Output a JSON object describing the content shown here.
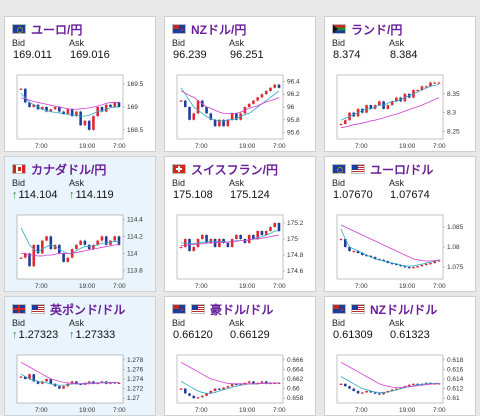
{
  "cards": [
    {
      "pair": "ユーロ/円",
      "flag": "eu",
      "bid_label": "Bid",
      "ask_label": "Ask",
      "bid": "169.011",
      "ask": "169.016",
      "arrow": "",
      "highlight": false,
      "y_ticks": [
        "169.5",
        "169",
        "168.5"
      ],
      "x_ticks": [
        "7:00",
        "19:00",
        "7:00"
      ],
      "ylim": [
        168.3,
        169.7
      ],
      "candles": [
        169.4,
        169.1,
        169.0,
        169.05,
        168.95,
        169.0,
        168.9,
        168.95,
        169.0,
        168.9,
        168.85,
        168.95,
        168.8,
        168.9,
        168.6,
        168.7,
        168.5,
        168.8,
        169.0,
        168.9,
        169.05,
        169.0,
        169.1,
        169.0
      ],
      "ma1": [
        169.3,
        169.2,
        169.1,
        169.05,
        169.0,
        168.95,
        168.92,
        168.9,
        168.88,
        168.87,
        168.85,
        168.84,
        168.83,
        168.82,
        168.8,
        168.8,
        168.82,
        168.86,
        168.9,
        168.92,
        168.95,
        168.98,
        169.0,
        169.0
      ],
      "ma2": [
        169.2,
        169.18,
        169.15,
        169.12,
        169.1,
        169.08,
        169.06,
        169.04,
        169.02,
        169.0,
        168.98,
        168.96,
        168.95,
        168.95,
        168.96,
        168.97,
        168.98,
        169.0,
        169.02,
        169.05,
        169.08,
        169.1,
        169.1,
        169.1
      ]
    },
    {
      "pair": "NZドル/円",
      "flag": "nz",
      "bid_label": "Bid",
      "ask_label": "Ask",
      "bid": "96.239",
      "ask": "96.251",
      "arrow": "",
      "highlight": false,
      "y_ticks": [
        "96.4",
        "96.2",
        "96",
        "95.8",
        "95.6"
      ],
      "x_ticks": [
        "7:00",
        "19:00",
        "7:00"
      ],
      "ylim": [
        95.5,
        96.5
      ],
      "candles": [
        96.1,
        96.0,
        95.8,
        95.9,
        96.1,
        96.0,
        95.9,
        95.8,
        95.7,
        95.8,
        95.7,
        95.8,
        95.9,
        95.8,
        95.9,
        96.0,
        96.05,
        96.1,
        96.15,
        96.2,
        96.25,
        96.3,
        96.35,
        96.3
      ],
      "ma1": [
        96.3,
        96.2,
        96.1,
        96.0,
        95.95,
        95.9,
        95.85,
        95.82,
        95.8,
        95.78,
        95.78,
        95.8,
        95.8,
        95.82,
        95.85,
        95.88,
        95.9,
        95.95,
        96.0,
        96.05,
        96.1,
        96.15,
        96.2,
        96.25
      ],
      "ma2": [
        96.25,
        96.22,
        96.18,
        96.15,
        96.1,
        96.05,
        96.0,
        95.98,
        95.95,
        95.92,
        95.9,
        95.9,
        95.9,
        95.9,
        95.92,
        95.95,
        95.98,
        96.0,
        96.02,
        96.05,
        96.08,
        96.1,
        96.12,
        96.15
      ]
    },
    {
      "pair": "ランド/円",
      "flag": "za",
      "bid_label": "Bid",
      "ask_label": "Ask",
      "bid": "8.374",
      "ask": "8.384",
      "arrow": "",
      "highlight": false,
      "y_ticks": [
        "8.35",
        "8.3",
        "8.25"
      ],
      "x_ticks": [
        "7:00",
        "19:00",
        "7:00"
      ],
      "ylim": [
        8.23,
        8.4
      ],
      "candles": [
        8.27,
        8.28,
        8.3,
        8.29,
        8.31,
        8.3,
        8.32,
        8.31,
        8.32,
        8.33,
        8.31,
        8.32,
        8.33,
        8.34,
        8.33,
        8.35,
        8.34,
        8.36,
        8.36,
        8.37,
        8.37,
        8.38,
        8.38,
        8.38
      ],
      "ma1": [
        8.28,
        8.285,
        8.29,
        8.295,
        8.3,
        8.305,
        8.31,
        8.31,
        8.315,
        8.32,
        8.32,
        8.325,
        8.33,
        8.33,
        8.335,
        8.34,
        8.345,
        8.35,
        8.355,
        8.36,
        8.365,
        8.37,
        8.372,
        8.375
      ],
      "ma2": [
        8.26,
        8.262,
        8.265,
        8.268,
        8.27,
        8.272,
        8.275,
        8.278,
        8.28,
        8.283,
        8.286,
        8.29,
        8.293,
        8.296,
        8.3,
        8.304,
        8.308,
        8.312,
        8.316,
        8.32,
        8.325,
        8.33,
        8.335,
        8.34
      ]
    },
    {
      "pair": "カナダドル/円",
      "flag": "ca",
      "bid_label": "Bid",
      "ask_label": "Ask",
      "bid": "114.104",
      "ask": "114.119",
      "arrow": "↑",
      "highlight": true,
      "y_ticks": [
        "114.4",
        "114.2",
        "114",
        "113.8"
      ],
      "x_ticks": [
        "7:00",
        "19:00",
        "7:00"
      ],
      "ylim": [
        113.7,
        114.45
      ],
      "candles": [
        113.95,
        114.0,
        113.85,
        114.1,
        114.0,
        114.15,
        114.2,
        114.05,
        114.1,
        114.0,
        113.9,
        113.95,
        114.05,
        114.1,
        114.15,
        114.1,
        114.05,
        114.1,
        114.15,
        114.2,
        114.1,
        114.15,
        114.2,
        114.1
      ],
      "ma1": [
        114.3,
        114.2,
        114.1,
        114.05,
        114.02,
        114.05,
        114.08,
        114.1,
        114.08,
        114.05,
        114.02,
        114.0,
        114.0,
        114.03,
        114.06,
        114.08,
        114.08,
        114.09,
        114.1,
        114.12,
        114.12,
        114.13,
        114.14,
        114.14
      ],
      "ma2": [
        114.0,
        114.0,
        113.98,
        113.98,
        113.97,
        113.97,
        113.98,
        113.98,
        113.99,
        114.0,
        114.0,
        114.0,
        114.0,
        114.01,
        114.02,
        114.03,
        114.04,
        114.05,
        114.06,
        114.07,
        114.08,
        114.09,
        114.1,
        114.1
      ]
    },
    {
      "pair": "スイスフラン/円",
      "flag": "ch",
      "bid_label": "Bid",
      "ask_label": "Ask",
      "bid": "175.108",
      "ask": "175.124",
      "arrow": "",
      "highlight": false,
      "y_ticks": [
        "175.2",
        "175",
        "174.8",
        "174.6"
      ],
      "x_ticks": [
        "7:00",
        "19:00",
        "7:00"
      ],
      "ylim": [
        174.5,
        175.3
      ],
      "candles": [
        174.9,
        175.0,
        174.85,
        174.9,
        175.0,
        175.05,
        174.95,
        175.0,
        174.9,
        175.0,
        174.95,
        174.9,
        175.0,
        175.05,
        175.0,
        174.95,
        175.05,
        175.0,
        175.1,
        175.05,
        175.1,
        175.15,
        175.2,
        175.1
      ],
      "ma1": [
        174.95,
        174.95,
        174.94,
        174.94,
        174.95,
        174.96,
        174.96,
        174.97,
        174.97,
        174.97,
        174.97,
        174.96,
        174.97,
        174.98,
        174.98,
        174.98,
        174.99,
        175.0,
        175.02,
        175.03,
        175.05,
        175.07,
        175.1,
        175.1
      ],
      "ma2": [
        174.92,
        174.92,
        174.93,
        174.93,
        174.94,
        174.94,
        174.95,
        174.95,
        174.95,
        174.96,
        174.96,
        174.96,
        174.97,
        174.97,
        174.98,
        174.98,
        174.99,
        175.0,
        175.0,
        175.01,
        175.02,
        175.03,
        175.04,
        175.05
      ]
    },
    {
      "pair": "ユーロ/ドル",
      "flag": "eu_us",
      "bid_label": "Bid",
      "ask_label": "Ask",
      "bid": "1.07670",
      "ask": "1.07674",
      "arrow": "",
      "highlight": false,
      "y_ticks": [
        "1.085",
        "1.08",
        "1.075"
      ],
      "x_ticks": [
        "7:00",
        "19:00",
        "7:00"
      ],
      "ylim": [
        1.072,
        1.088
      ],
      "candles": [
        1.082,
        1.08,
        1.079,
        1.079,
        1.0785,
        1.078,
        1.0778,
        1.0775,
        1.077,
        1.0768,
        1.0765,
        1.076,
        1.0758,
        1.0755,
        1.0752,
        1.075,
        1.0748,
        1.075,
        1.0752,
        1.0755,
        1.0758,
        1.076,
        1.0765,
        1.0767
      ],
      "ma1": [
        1.0845,
        1.082,
        1.08,
        1.0795,
        1.079,
        1.0785,
        1.078,
        1.0775,
        1.077,
        1.0768,
        1.0765,
        1.0762,
        1.076,
        1.0758,
        1.0755,
        1.0753,
        1.0752,
        1.0753,
        1.0755,
        1.0757,
        1.076,
        1.0762,
        1.0765,
        1.0767
      ],
      "ma2": [
        1.0855,
        1.085,
        1.0845,
        1.084,
        1.0835,
        1.083,
        1.0825,
        1.082,
        1.0815,
        1.081,
        1.0805,
        1.08,
        1.0795,
        1.079,
        1.0785,
        1.078,
        1.0775,
        1.077,
        1.0768,
        1.0766,
        1.0765,
        1.0765,
        1.0766,
        1.0767
      ]
    },
    {
      "pair": "英ポンド/ドル",
      "flag": "gb_us",
      "bid_label": "Bid",
      "ask_label": "Ask",
      "bid": "1.27323",
      "ask": "1.27333",
      "arrow": "↑",
      "highlight": true,
      "y_ticks": [
        "1.278",
        "1.276",
        "1.274",
        "1.272",
        "1.27"
      ],
      "x_ticks": [
        "7:00",
        "19:00",
        "7:00"
      ],
      "ylim": [
        1.269,
        1.279
      ],
      "candles": [
        1.2745,
        1.274,
        1.275,
        1.2735,
        1.273,
        1.2735,
        1.274,
        1.273,
        1.2725,
        1.272,
        1.2725,
        1.273,
        1.2735,
        1.273,
        1.2728,
        1.2732,
        1.2735,
        1.273,
        1.2732,
        1.2735,
        1.273,
        1.2733,
        1.2732,
        1.2732
      ],
      "ma1": [
        1.275,
        1.2745,
        1.274,
        1.2738,
        1.2735,
        1.2733,
        1.2732,
        1.273,
        1.2728,
        1.2727,
        1.2727,
        1.2728,
        1.273,
        1.273,
        1.273,
        1.2731,
        1.2732,
        1.2732,
        1.2732,
        1.2733,
        1.2733,
        1.2733,
        1.2733,
        1.2733
      ],
      "ma2": [
        1.2775,
        1.277,
        1.2765,
        1.276,
        1.2755,
        1.275,
        1.2745,
        1.274,
        1.2738,
        1.2735,
        1.2733,
        1.2732,
        1.2731,
        1.273,
        1.273,
        1.273,
        1.273,
        1.2731,
        1.2731,
        1.2732,
        1.2732,
        1.2732,
        1.2733,
        1.2733
      ]
    },
    {
      "pair": "豪ドル/ドル",
      "flag": "au_us",
      "bid_label": "Bid",
      "ask_label": "Ask",
      "bid": "0.66120",
      "ask": "0.66129",
      "arrow": "",
      "highlight": false,
      "y_ticks": [
        "0.666",
        "0.664",
        "0.662",
        "0.66",
        "0.658"
      ],
      "x_ticks": [
        "7:00",
        "19:00",
        "7:00"
      ],
      "ylim": [
        0.657,
        0.667
      ],
      "candles": [
        0.66,
        0.659,
        0.6585,
        0.658,
        0.6582,
        0.6585,
        0.659,
        0.6595,
        0.66,
        0.6598,
        0.6602,
        0.6605,
        0.661,
        0.6608,
        0.661,
        0.6612,
        0.6615,
        0.661,
        0.6612,
        0.6615,
        0.661,
        0.6612,
        0.6612,
        0.6612
      ],
      "ma1": [
        0.6615,
        0.661,
        0.6605,
        0.66,
        0.6595,
        0.6592,
        0.659,
        0.659,
        0.6592,
        0.6595,
        0.6598,
        0.66,
        0.6603,
        0.6605,
        0.6607,
        0.6608,
        0.661,
        0.661,
        0.661,
        0.6611,
        0.6611,
        0.6612,
        0.6612,
        0.6612
      ],
      "ma2": [
        0.6655,
        0.665,
        0.6645,
        0.664,
        0.6635,
        0.663,
        0.6625,
        0.662,
        0.6618,
        0.6615,
        0.6613,
        0.6611,
        0.661,
        0.661,
        0.661,
        0.661,
        0.661,
        0.661,
        0.661,
        0.6611,
        0.6611,
        0.6611,
        0.6612,
        0.6612
      ]
    },
    {
      "pair": "NZドル/ドル",
      "flag": "nz_us",
      "bid_label": "Bid",
      "ask_label": "Ask",
      "bid": "0.61309",
      "ask": "0.61323",
      "arrow": "",
      "highlight": false,
      "y_ticks": [
        "0.618",
        "0.616",
        "0.614",
        "0.612",
        "0.61"
      ],
      "x_ticks": [
        "7:00",
        "19:00",
        "7:00"
      ],
      "ylim": [
        0.609,
        0.619
      ],
      "candles": [
        0.613,
        0.6125,
        0.612,
        0.6115,
        0.611,
        0.6112,
        0.6115,
        0.6112,
        0.611,
        0.6108,
        0.6112,
        0.6115,
        0.6118,
        0.612,
        0.6122,
        0.6125,
        0.6128,
        0.613,
        0.6128,
        0.613,
        0.6132,
        0.613,
        0.6131,
        0.6131
      ],
      "ma1": [
        0.6145,
        0.614,
        0.6135,
        0.613,
        0.6125,
        0.612,
        0.6118,
        0.6115,
        0.6113,
        0.6112,
        0.6112,
        0.6113,
        0.6115,
        0.6117,
        0.612,
        0.6122,
        0.6124,
        0.6126,
        0.6128,
        0.6129,
        0.613,
        0.613,
        0.6131,
        0.6131
      ],
      "ma2": [
        0.6175,
        0.617,
        0.6165,
        0.616,
        0.6155,
        0.615,
        0.6145,
        0.614,
        0.6135,
        0.613,
        0.6127,
        0.6125,
        0.6123,
        0.6122,
        0.6122,
        0.6123,
        0.6124,
        0.6125,
        0.6126,
        0.6127,
        0.6128,
        0.6129,
        0.613,
        0.613
      ]
    }
  ]
}
